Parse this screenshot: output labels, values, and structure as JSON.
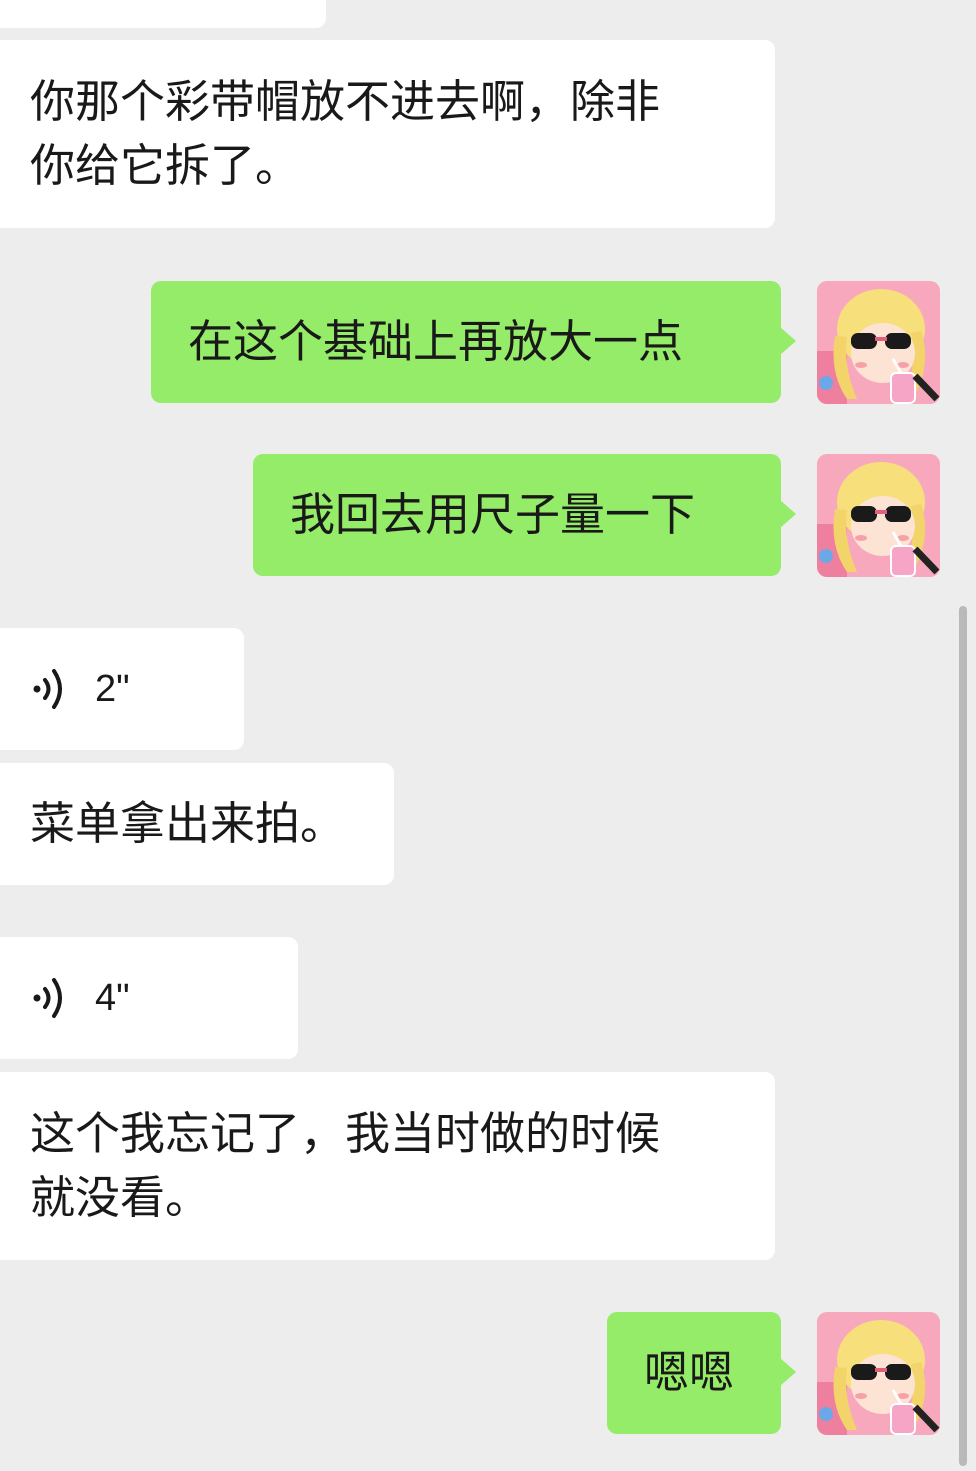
{
  "chat": {
    "messages": [
      {
        "id": "m1",
        "side": "in",
        "type": "text",
        "text": "你那个彩带帽放不进去啊，除非\n你给它拆了。"
      },
      {
        "id": "m2",
        "side": "out",
        "type": "text",
        "text": "在这个基础上再放大一点"
      },
      {
        "id": "m3",
        "side": "out",
        "type": "text",
        "text": "我回去用尺子量一下"
      },
      {
        "id": "m4",
        "side": "in",
        "type": "voice",
        "duration": "2\""
      },
      {
        "id": "m5",
        "side": "in",
        "type": "text",
        "text": "菜单拿出来拍。"
      },
      {
        "id": "m6",
        "side": "in",
        "type": "voice",
        "duration": "4\""
      },
      {
        "id": "m7",
        "side": "in",
        "type": "text",
        "text": "这个我忘记了，我当时做的时候\n就没看。"
      },
      {
        "id": "m8",
        "side": "out",
        "type": "text",
        "text": "嗯嗯"
      }
    ]
  },
  "icons": {
    "voice": "voice-wave-icon",
    "avatar": "avatar-sunglasses-girl"
  },
  "colors": {
    "background": "#ededed",
    "incoming_bubble": "#ffffff",
    "outgoing_bubble": "#95ec69",
    "text": "#191919"
  }
}
